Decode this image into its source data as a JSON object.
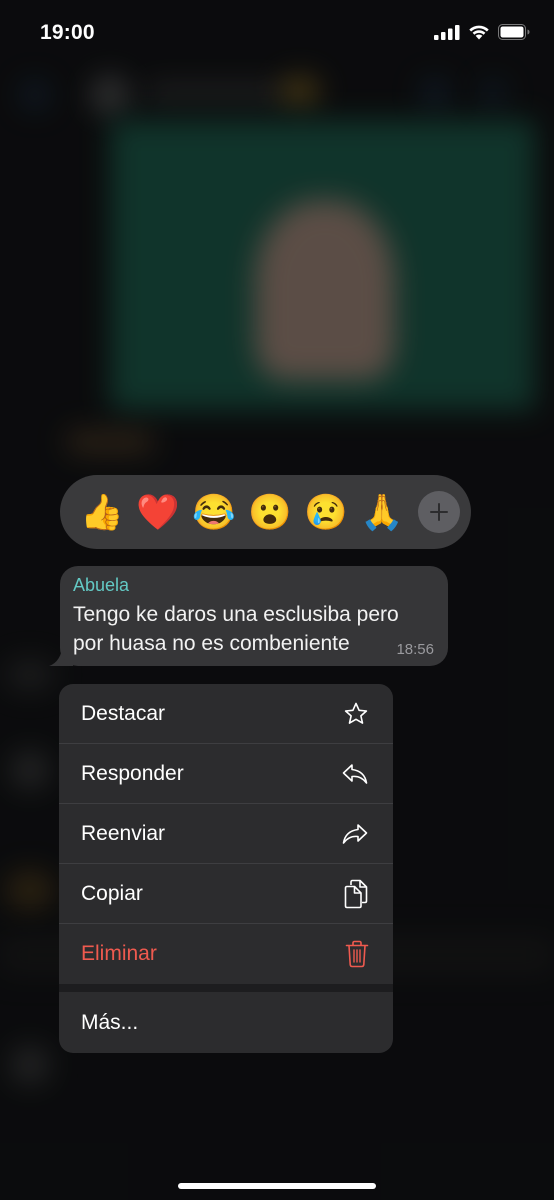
{
  "status_bar": {
    "time": "19:00"
  },
  "reactions": [
    {
      "name": "thumbs-up",
      "glyph": "👍"
    },
    {
      "name": "heart",
      "glyph": "❤️"
    },
    {
      "name": "tears-of-joy",
      "glyph": "😂"
    },
    {
      "name": "surprised",
      "glyph": "😮"
    },
    {
      "name": "crying",
      "glyph": "😢"
    },
    {
      "name": "folded-hands",
      "glyph": "🙏"
    }
  ],
  "message": {
    "sender": "Abuela",
    "text": "Tengo ke daros una esclusiba pero por huasa no es combeniente",
    "time": "18:56"
  },
  "menu": {
    "destacar": "Destacar",
    "responder": "Responder",
    "reenviar": "Reenviar",
    "copiar": "Copiar",
    "eliminar": "Eliminar",
    "mas": "Más..."
  },
  "colors": {
    "sender": "#63c9c4",
    "danger": "#ef5a4f",
    "menu_bg": "#2c2c2e",
    "bubble_bg": "#363638"
  }
}
